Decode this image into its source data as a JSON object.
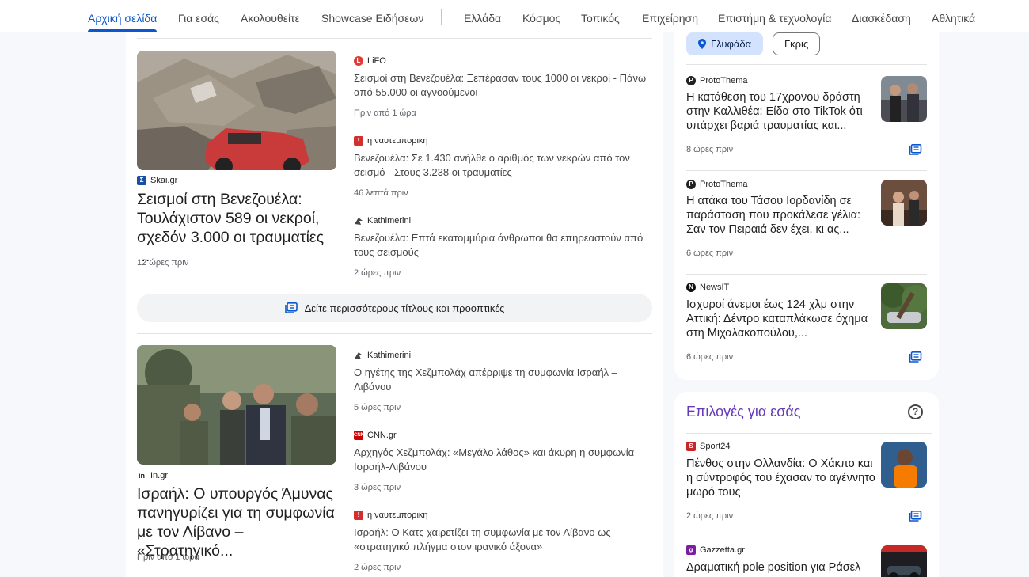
{
  "nav": {
    "tabs": [
      {
        "label": "Αρχική σελίδα"
      },
      {
        "label": "Για εσάς"
      },
      {
        "label": "Ακολουθείτε"
      },
      {
        "label": "Showcase Ειδήσεων"
      },
      {
        "label": "Ελλάδα"
      },
      {
        "label": "Κόσμος"
      },
      {
        "label": "Τοπικός"
      },
      {
        "label": "Επιχείρηση"
      },
      {
        "label": "Επιστήμη & τεχνολογία"
      },
      {
        "label": "Διασκέδαση"
      },
      {
        "label": "Αθλητικά"
      }
    ],
    "active_tab": "Αρχική σελίδα"
  },
  "stories": [
    {
      "hero": {
        "image": "earthquake-rubble-photo",
        "source": "Skai.gr",
        "title": "Σεισμοί στη Βενεζουέλα: Τουλάχιστον 589 οι νεκροί, σχεδόν 3.000 οι τραυματίες ...",
        "time": "12 ώρες πριν"
      },
      "articles": [
        {
          "source": "LiFO",
          "title": "Σεισμοί στη Βενεζουέλα: Ξεπέρασαν τους 1000 οι νεκροί - Πάνω από 55.000 οι αγνοούμενοι",
          "time": "Πριν από 1 ώρα"
        },
        {
          "source": "η ναυτεμπορικη",
          "title": "Βενεζουέλα: Σε 1.430 ανήλθε ο αριθμός των νεκρών από τον σεισμό - Στους 3.238 οι τραυματίες",
          "time": "46 λεπτά πριν"
        },
        {
          "source": "Kathimerini",
          "title": "Βενεζουέλα: Επτά εκατομμύρια άνθρωποι θα επηρεαστούν από τους σεισμούς",
          "time": "2 ώρες πριν"
        }
      ]
    },
    {
      "hero": {
        "image": "soldiers-minister-photo",
        "source": "In.gr",
        "title": "Ισραήλ: Ο υπουργός Άμυνας πανηγυρίζει για τη συμφωνία με τον Λίβανο – «Στρατηγικό...",
        "time": "Πριν από 1 ώρα"
      },
      "articles": [
        {
          "source": "Kathimerini",
          "title": "Ο ηγέτης της Χεζμπολάχ απέρριψε τη συμφωνία Ισραήλ – Λιβάνου",
          "time": "5 ώρες πριν"
        },
        {
          "source": "CNN.gr",
          "title": "Αρχηγός Χεζμπολάχ: «Μεγάλο λάθος» και άκυρη η συμφωνία Ισραήλ-Λιβάνου",
          "time": "3 ώρες πριν"
        },
        {
          "source": "η ναυτεμπορικη",
          "title": "Ισραήλ: Ο Κατς χαιρετίζει τη συμφωνία με τον Λίβανο ως «στρατηγικό πλήγμα στον ιρανικό άξονα»",
          "time": "2 ώρες πριν"
        }
      ]
    }
  ],
  "more_button": {
    "label": "Δείτε περισσότερους τίτλους και προοπτικές",
    "icon": "full-coverage-icon"
  },
  "local": {
    "chips": [
      {
        "label": "Γλυφάδα",
        "icon": "location-pin-icon",
        "selected": true
      },
      {
        "label": "Γκρις",
        "selected": false
      }
    ],
    "items": [
      {
        "source": "ProtoThema",
        "title": "Η κατάθεση του 17χρονου δράστη στην Καλλιθέα: Είδα στο TikTok ότι υπάρχει βαριά τραυματίας και...",
        "time": "8 ώρες πριν"
      },
      {
        "source": "ProtoThema",
        "title": "Η ατάκα του Τάσου Ιορδανίδη σε παράσταση που προκάλεσε γέλια: Σαν τον Πειραιά δεν έχει, κι ας...",
        "time": "6 ώρες πριν"
      },
      {
        "source": "NewsIT",
        "title": "Ισχυροί άνεμοι έως 124 χλμ στην Αττική: Δέντρο καταπλάκωσε όχημα στη Μιχαλακοπούλου,...",
        "time": "6 ώρες πριν"
      }
    ]
  },
  "picks": {
    "title": "Επιλογές για εσάς",
    "help_icon": "help-icon",
    "items": [
      {
        "source": "Sport24",
        "title": "Πένθος στην Ολλανδία: Ο Χάκπο και η σύντροφός του έχασαν το αγέννητο μωρό τους",
        "time": "2 ώρες πριν"
      },
      {
        "source": "Gazzetta.gr",
        "title": "Δραματική pole position για Ράσελ"
      }
    ]
  },
  "colors": {
    "accent": "#0b57d0",
    "section_title": "#673ab7",
    "page_bg": "#f6f8fc"
  }
}
